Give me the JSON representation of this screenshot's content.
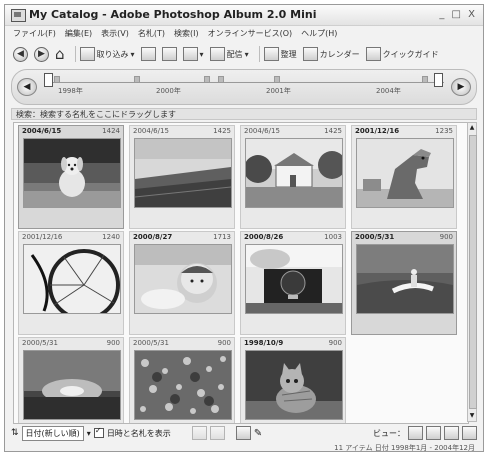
{
  "window": {
    "title": "My Catalog - Adobe Photoshop Album 2.0 Mini",
    "controls": "_ □ X"
  },
  "menu": [
    "ファイル(F)",
    "編集(E)",
    "表示(V)",
    "名札(T)",
    "検索(I)",
    "オンラインサービス(O)",
    "ヘルプ(H)"
  ],
  "toolbar": {
    "import_label": "取り込み",
    "share_label": "配信",
    "organize_label": "整理",
    "calendar_label": "カレンダー",
    "quickguide_label": "クイックガイド"
  },
  "timeline": {
    "years": [
      "1998年",
      "2000年",
      "2001年",
      "2004年"
    ]
  },
  "find_bar": "検索：検索する名札をここにドラッグします",
  "photos": [
    {
      "date": "2004/6/15",
      "time": "1424",
      "bold": true,
      "subject": "dog"
    },
    {
      "date": "2004/6/15",
      "time": "1425",
      "bold": false,
      "subject": "field"
    },
    {
      "date": "2004/6/15",
      "time": "1425",
      "bold": false,
      "subject": "house"
    },
    {
      "date": "2001/12/16",
      "time": "1235",
      "bold": true,
      "subject": "dinosaur"
    },
    {
      "date": "2001/12/16",
      "time": "1240",
      "bold": false,
      "subject": "wheel"
    },
    {
      "date": "2000/8/27",
      "time": "1713",
      "bold": true,
      "subject": "baby"
    },
    {
      "date": "2000/8/26",
      "time": "1003",
      "bold": true,
      "subject": "train"
    },
    {
      "date": "2000/5/31",
      "time": "900",
      "bold": true,
      "subject": "jetski"
    },
    {
      "date": "2000/5/31",
      "time": "900",
      "bold": false,
      "subject": "sunset"
    },
    {
      "date": "2000/5/31",
      "time": "900",
      "bold": false,
      "subject": "flowers"
    },
    {
      "date": "1998/10/9",
      "time": "900",
      "bold": true,
      "subject": "cat"
    }
  ],
  "bottom": {
    "sort_label": "日付(新しい順)",
    "show_label": "日時と名札を表示",
    "view_label": "ビュー："
  },
  "status": "11 アイテム 日付 1998年1月 - 2004年12月"
}
